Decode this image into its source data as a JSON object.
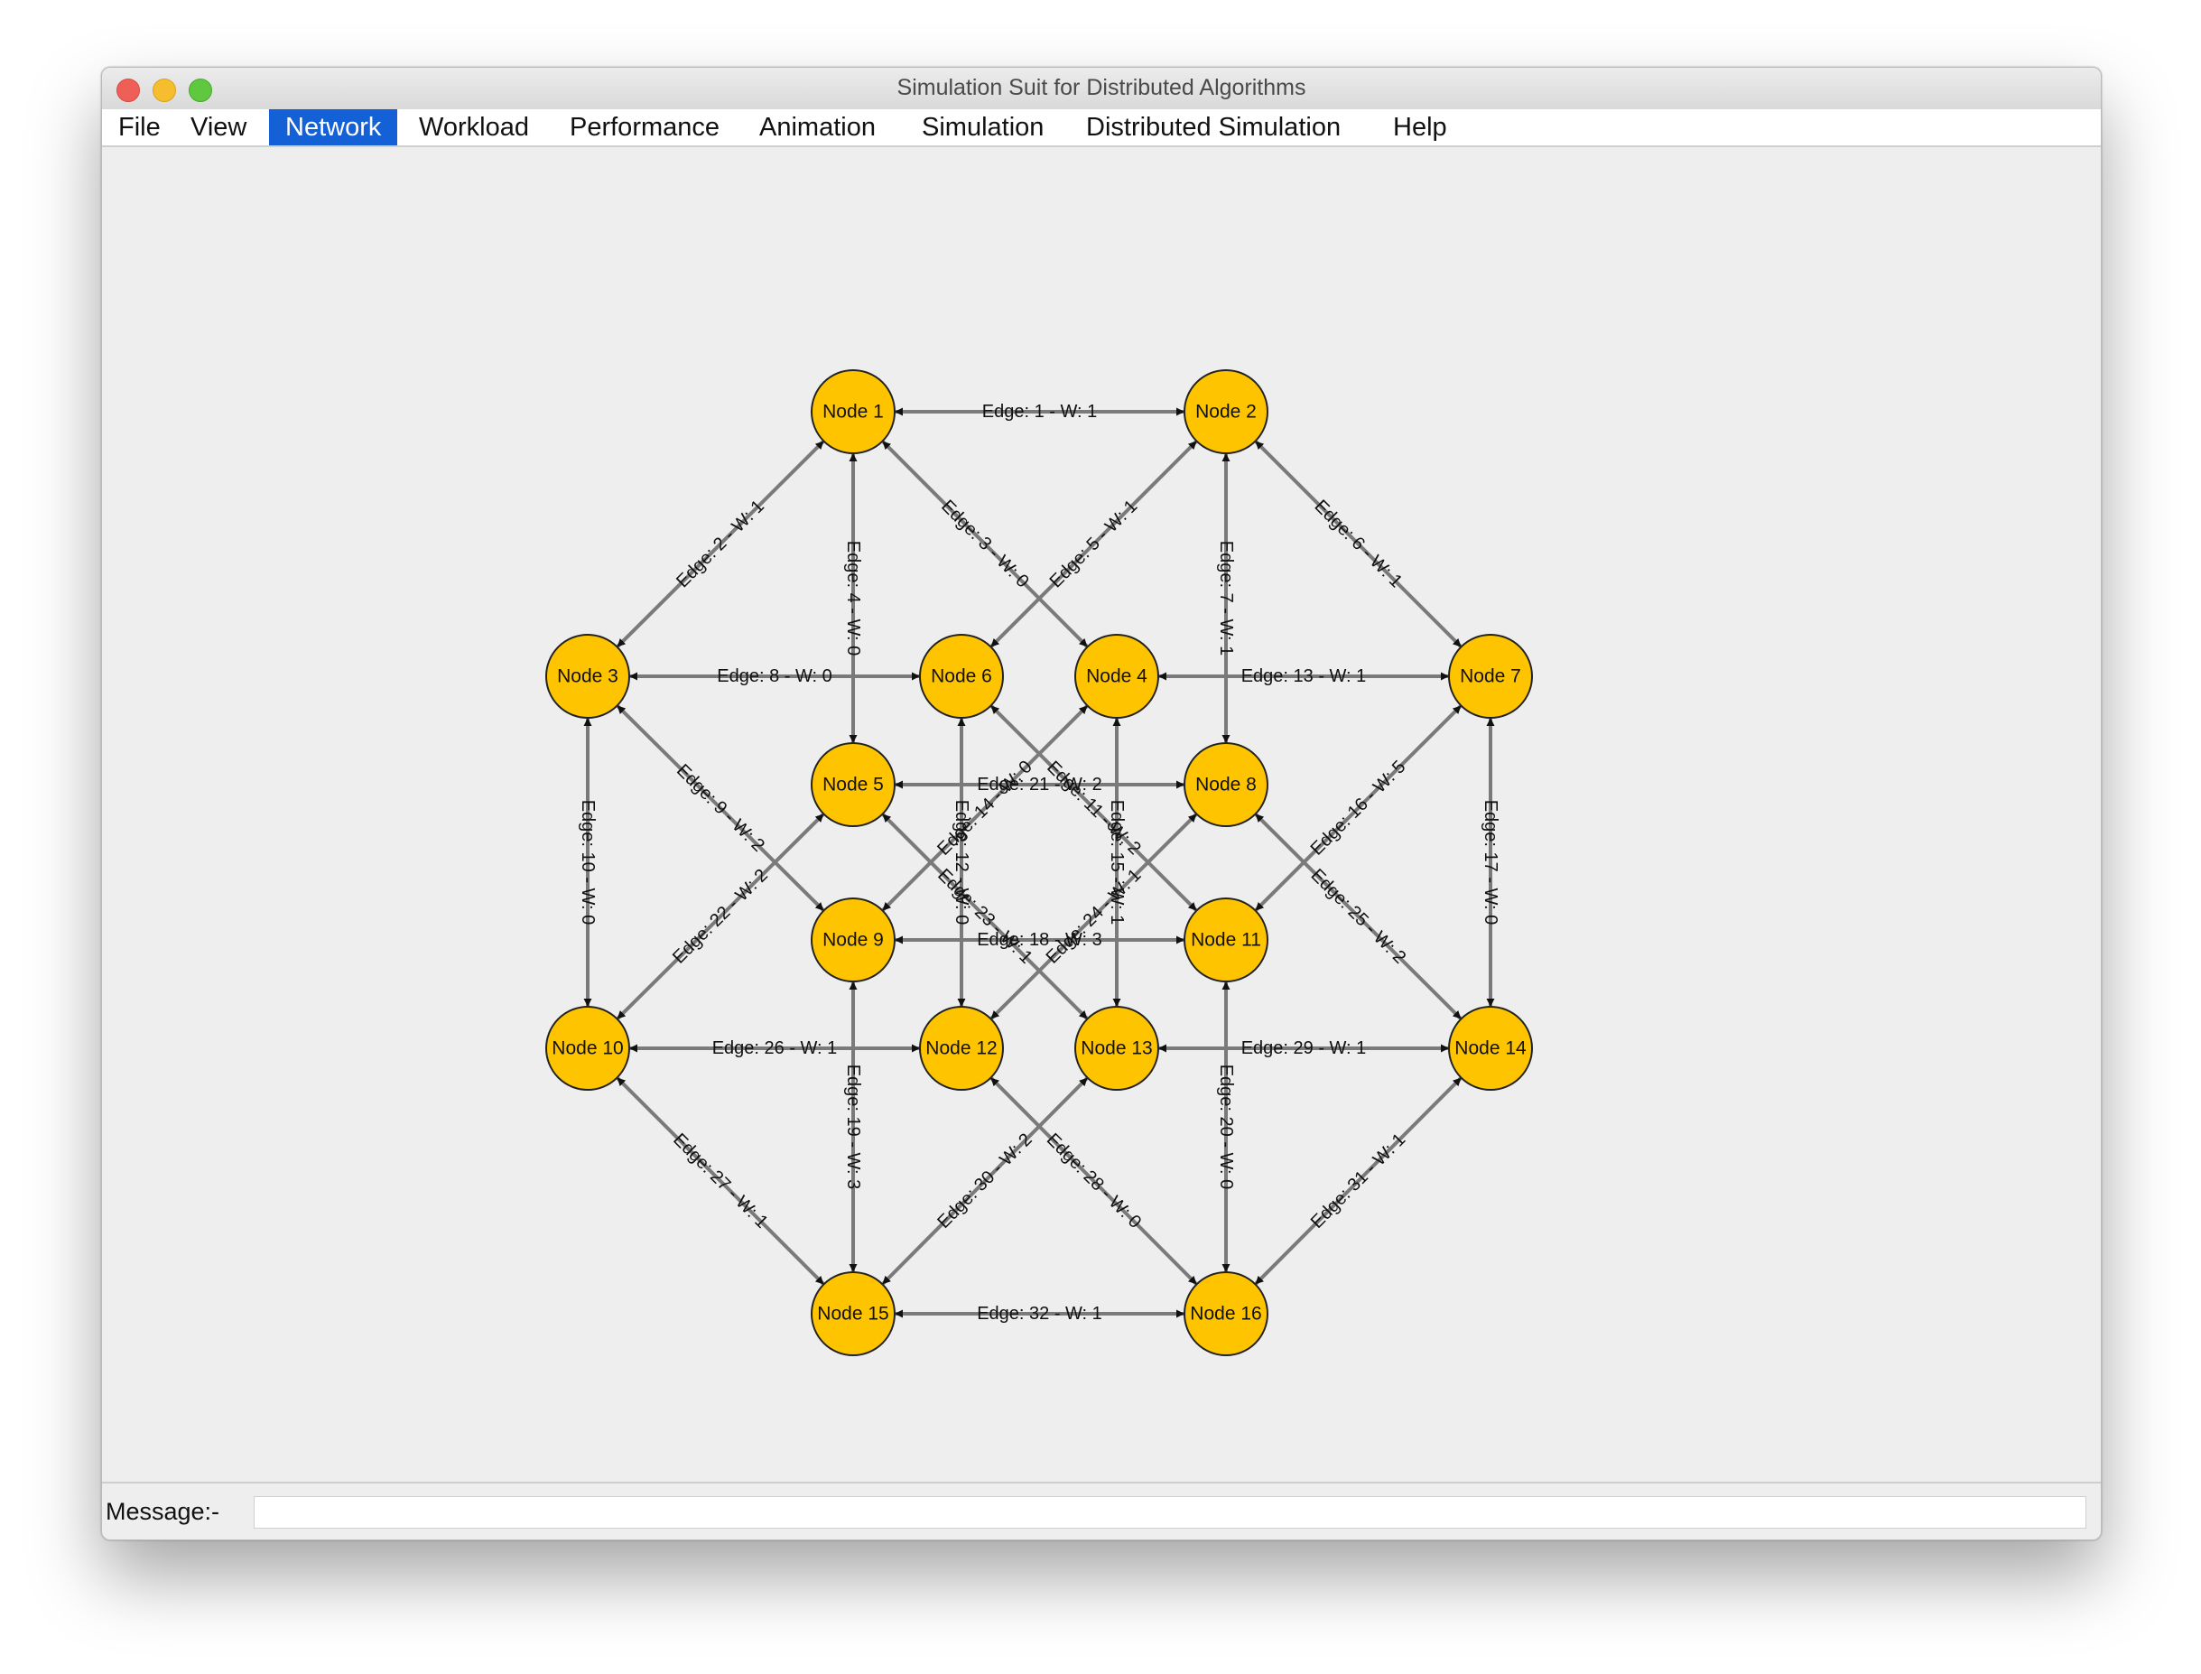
{
  "window": {
    "title": "Simulation Suit for Distributed Algorithms"
  },
  "menu": {
    "items": [
      {
        "label": "File"
      },
      {
        "label": "View"
      },
      {
        "label": "Network",
        "active": true
      },
      {
        "label": "Workload"
      },
      {
        "label": "Performance"
      },
      {
        "label": "Animation"
      },
      {
        "label": "Simulation"
      },
      {
        "label": "Distributed Simulation"
      },
      {
        "label": "Help"
      }
    ]
  },
  "graph": {
    "node_color": "#ffc400",
    "edge_color": "#7a7a7a",
    "nodes": [
      {
        "id": 1,
        "label": "Node 1"
      },
      {
        "id": 2,
        "label": "Node 2"
      },
      {
        "id": 3,
        "label": "Node 3"
      },
      {
        "id": 4,
        "label": "Node 4"
      },
      {
        "id": 5,
        "label": "Node 5"
      },
      {
        "id": 6,
        "label": "Node 6"
      },
      {
        "id": 7,
        "label": "Node 7"
      },
      {
        "id": 8,
        "label": "Node 8"
      },
      {
        "id": 9,
        "label": "Node 9"
      },
      {
        "id": 10,
        "label": "Node 10"
      },
      {
        "id": 11,
        "label": "Node 11"
      },
      {
        "id": 12,
        "label": "Node 12"
      },
      {
        "id": 13,
        "label": "Node 13"
      },
      {
        "id": 14,
        "label": "Node 14"
      },
      {
        "id": 15,
        "label": "Node 15"
      },
      {
        "id": 16,
        "label": "Node 16"
      }
    ],
    "edges": [
      {
        "from": 1,
        "to": 2,
        "label": "Edge: 1 - W: 1"
      },
      {
        "from": 1,
        "to": 3,
        "label": "Edge: 2 - W: 1"
      },
      {
        "from": 1,
        "to": 4,
        "label": "Edge: 3 - W: 0"
      },
      {
        "from": 1,
        "to": 5,
        "label": "Edge: 4 - W: 0"
      },
      {
        "from": 2,
        "to": 6,
        "label": "Edge: 5 - W: 1"
      },
      {
        "from": 2,
        "to": 7,
        "label": "Edge: 6 - W: 1"
      },
      {
        "from": 2,
        "to": 8,
        "label": "Edge: 7 - W: 1"
      },
      {
        "from": 3,
        "to": 6,
        "label": "Edge: 8 - W: 0"
      },
      {
        "from": 3,
        "to": 9,
        "label": "Edge: 9 - W: 2"
      },
      {
        "from": 3,
        "to": 10,
        "label": "Edge: 10 - W: 0"
      },
      {
        "from": 6,
        "to": 11,
        "label": "Edge: 11 - W: 2"
      },
      {
        "from": 6,
        "to": 12,
        "label": "Edge: 12 - W: 0"
      },
      {
        "from": 4,
        "to": 7,
        "label": "Edge: 13 - W: 1"
      },
      {
        "from": 4,
        "to": 9,
        "label": "Edge: 14 - W: 0"
      },
      {
        "from": 4,
        "to": 13,
        "label": "Edge: 15 - W: 1"
      },
      {
        "from": 7,
        "to": 11,
        "label": "Edge: 16 - W: 5"
      },
      {
        "from": 7,
        "to": 14,
        "label": "Edge: 17 - W: 0"
      },
      {
        "from": 9,
        "to": 11,
        "label": "Edge: 18 - W: 3"
      },
      {
        "from": 9,
        "to": 15,
        "label": "Edge: 19 - W: 3"
      },
      {
        "from": 11,
        "to": 16,
        "label": "Edge: 20 - W: 0"
      },
      {
        "from": 5,
        "to": 8,
        "label": "Edge: 21 - W: 2"
      },
      {
        "from": 5,
        "to": 10,
        "label": "Edge: 22 - W: 2"
      },
      {
        "from": 5,
        "to": 13,
        "label": "Edge: 23 - W: 1"
      },
      {
        "from": 8,
        "to": 12,
        "label": "Edge: 24 - W: 1"
      },
      {
        "from": 8,
        "to": 14,
        "label": "Edge: 25 - W: 2"
      },
      {
        "from": 10,
        "to": 12,
        "label": "Edge: 26 - W: 1"
      },
      {
        "from": 10,
        "to": 15,
        "label": "Edge: 27 - W: 1"
      },
      {
        "from": 12,
        "to": 16,
        "label": "Edge: 28 - W: 0"
      },
      {
        "from": 13,
        "to": 14,
        "label": "Edge: 29 - W: 1"
      },
      {
        "from": 13,
        "to": 15,
        "label": "Edge: 30 - W: 2"
      },
      {
        "from": 14,
        "to": 16,
        "label": "Edge: 31 - W: 1"
      },
      {
        "from": 15,
        "to": 16,
        "label": "Edge: 32 - W: 1"
      }
    ]
  },
  "status": {
    "message_label": "Message:-",
    "message_value": ""
  }
}
